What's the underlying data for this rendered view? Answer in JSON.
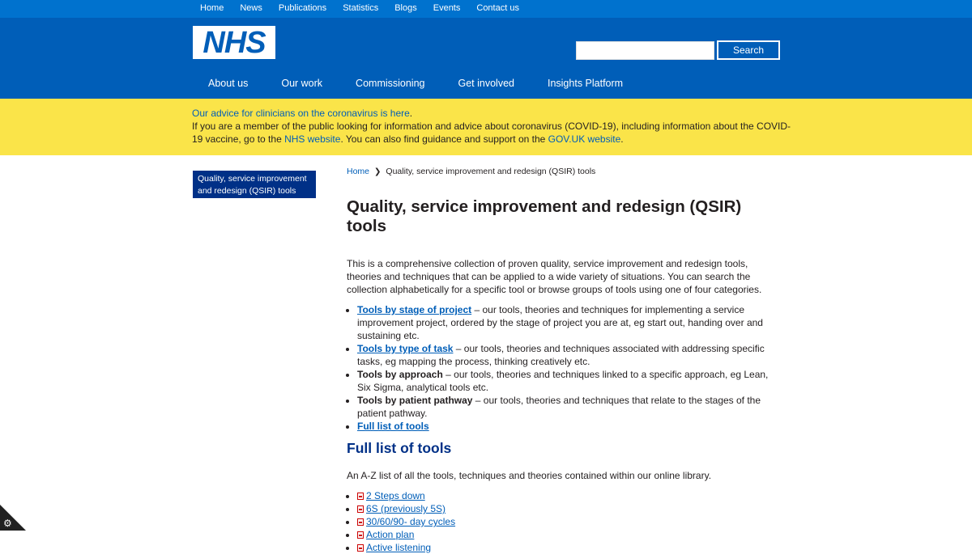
{
  "topnav": [
    "Home",
    "News",
    "Publications",
    "Statistics",
    "Blogs",
    "Events",
    "Contact us"
  ],
  "logo": "NHS",
  "search": {
    "placeholder": "",
    "button": "Search"
  },
  "mainnav": [
    "About us",
    "Our work",
    "Commissioning",
    "Get involved",
    "Insights Platform"
  ],
  "alert": {
    "line1_link": "Our advice for clinicians on the coronavirus is here",
    "line1_end": ".",
    "line2_a": "If you are a member of the public looking for information and advice about coronavirus (COVID-19), including information about the COVID-19 vaccine, go to the ",
    "nhs_link": "NHS website",
    "line2_b": ". You can also find guidance and support on the ",
    "gov_link": "GOV.UK website",
    "line2_c": "."
  },
  "sidebar": {
    "active_item": "Quality, service improvement and redesign (QSIR) tools"
  },
  "breadcrumb": {
    "home": "Home",
    "current": "Quality, service improvement and redesign (QSIR) tools"
  },
  "page_title": "Quality, service improvement and redesign (QSIR) tools",
  "intro": "This is a comprehensive collection of proven quality, service improvement and redesign tools, theories and techniques that can be applied to a wide variety of situations. You can search the collection alphabetically for a specific tool or browse groups of tools using one of four categories.",
  "categories": [
    {
      "title": "Tools by stage of project",
      "link": true,
      "desc": " – our tools, theories and techniques for implementing a service improvement project, ordered by the stage of project you are at, eg start out, handing over and sustaining etc."
    },
    {
      "title": "Tools by type of task",
      "link": true,
      "desc": " – our tools, theories and techniques associated with addressing specific tasks, eg mapping the process, thinking creatively etc."
    },
    {
      "title": "Tools by approach",
      "link": false,
      "desc": " – our tools, theories and techniques linked to a specific approach, eg Lean, Six Sigma, analytical tools etc."
    },
    {
      "title": "Tools by patient pathway",
      "link": false,
      "desc": " – our tools, theories and techniques that relate to the stages of the patient pathway."
    },
    {
      "title": "Full list of tools",
      "link": true,
      "desc": ""
    }
  ],
  "full_list": {
    "heading": "Full list of tools",
    "intro": "An A-Z list of all the tools, techniques and theories contained within our online library.",
    "items": [
      "2 Steps down",
      "6S (previously 5S)",
      "30/60/90- day cycles",
      "Action plan",
      "Active listening"
    ]
  },
  "corner_icon": "gear-icon"
}
